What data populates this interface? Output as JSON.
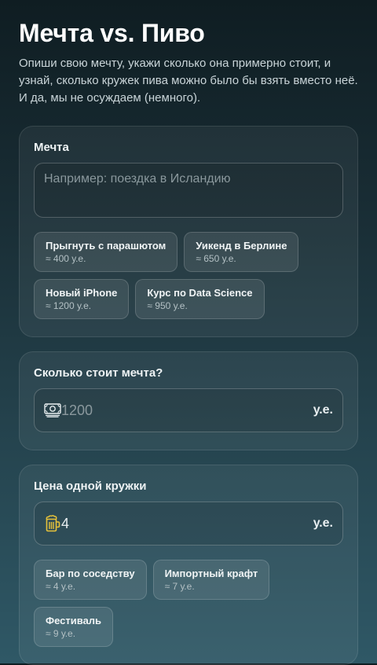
{
  "header": {
    "title": "Мечта vs. Пиво",
    "intro": "Опиши свою мечту, укажи сколько она примерно стоит, и узнай, сколько кружек пива можно было бы взять вместо неё. И да, мы не осуждаем (немного)."
  },
  "dream": {
    "label": "Мечта",
    "placeholder": "Например: поездка в Исландию",
    "presets": [
      {
        "title": "Прыгнуть с парашютом",
        "price": "≈ 400 у.е."
      },
      {
        "title": "Уикенд в Берлине",
        "price": "≈ 650 у.е."
      },
      {
        "title": "Новый iPhone",
        "price": "≈ 1200 у.е."
      },
      {
        "title": "Курс по Data Science",
        "price": "≈ 950 у.е."
      }
    ]
  },
  "cost": {
    "label": "Сколько стоит мечта?",
    "icon": "money-icon",
    "placeholder": "1200",
    "unit": "у.е."
  },
  "beer": {
    "label": "Цена одной кружки",
    "icon": "beer-mug-icon",
    "value": "4",
    "unit": "у.е.",
    "presets": [
      {
        "title": "Бар по соседству",
        "price": "≈ 4 у.е."
      },
      {
        "title": "Импортный крафт",
        "price": "≈ 7 у.е."
      },
      {
        "title": "Фестиваль",
        "price": "≈ 9 у.е."
      }
    ]
  },
  "colors": {
    "background_top": "#0f1d22",
    "background_bottom": "#2f5866",
    "beer_icon": "#e6c23a"
  }
}
